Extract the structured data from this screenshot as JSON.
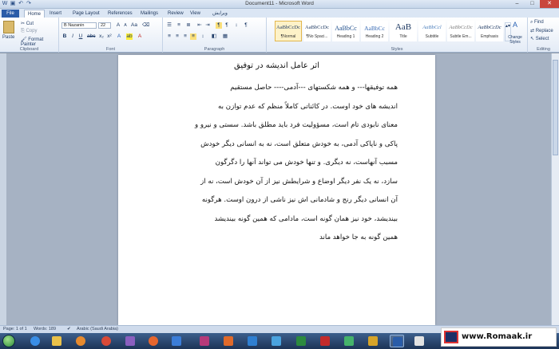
{
  "window": {
    "title": "Document11 - Microsoft Word",
    "controls": {
      "minimize": "–",
      "maximize": "□",
      "close": "✕"
    }
  },
  "tabs": [
    "File",
    "Home",
    "Insert",
    "Page Layout",
    "References",
    "Mailings",
    "Review",
    "View",
    "ویرایش"
  ],
  "active_tab": "Home",
  "ribbon": {
    "clipboard": {
      "paste": "Paste",
      "cut": "Cut",
      "copy": "Copy",
      "format_painter": "Format Painter",
      "label": "Clipboard"
    },
    "font": {
      "name": "B Nazanin",
      "size": "22",
      "label": "Font"
    },
    "paragraph": {
      "label": "Paragraph"
    },
    "styles": {
      "label": "Styles",
      "items": [
        {
          "sample": "AaBbCcDc",
          "name": "¶Normal"
        },
        {
          "sample": "AaBbCcDc",
          "name": "¶No Spaci..."
        },
        {
          "sample": "AaBbCc",
          "name": "Heading 1"
        },
        {
          "sample": "AaBbCc",
          "name": "Heading 2"
        },
        {
          "sample": "AaB",
          "name": "Title"
        },
        {
          "sample": "AaBbCcl",
          "name": "Subtitle"
        },
        {
          "sample": "AaBbCcDc",
          "name": "Subtle Em..."
        },
        {
          "sample": "AaBbCcDc",
          "name": "Emphasis"
        }
      ],
      "change_styles": "Change Styles"
    },
    "editing": {
      "find": "Find",
      "replace": "Replace",
      "select": "Select",
      "label": "Editing"
    }
  },
  "document": {
    "title": "اثر عامل اندیشه در توفیق",
    "lines": [
      "همه توفیقها--- و همه شکستهای ---آدمی---- حاصل مستقیم",
      "اندیشه های خود اوست. در کائناتی کاملاً منظم که عدم توازن به",
      "معنای نابودی تام است، مسؤولیت فرد باید مطلق باشد. سستی و نیرو و",
      "پاکی و ناپاکی آدمی، به خودش متعلق است، نه به انسانی دیگر خودش",
      "مسبب آنهاست، نه دیگری. و تنها خودش می تواند آنها را دگرگون",
      "سازد، نه یک نفر دیگر اوضاع و شرایطش نیز از آن خودش است، نه از",
      "آن انسانی دیگر رنج و شادمانی اش نیز ناشی از درون اوست. هرگونه",
      "بیندیشد، خود نیز همان گونه است، مادامی که  همین گونه بیندیشد",
      "همین گونه به جا خواهد ماند"
    ]
  },
  "status": {
    "page": "Page: 1 of 1",
    "words": "Words: 189",
    "language": "Arabic (Saudi Arabia)"
  },
  "watermark": "www.Romaak.ir",
  "colors": {
    "file_tab": "#2a5ca8",
    "taskbar": "#1d3457",
    "close_button": "#c9463d",
    "style_selected": "#fdf2c8"
  }
}
